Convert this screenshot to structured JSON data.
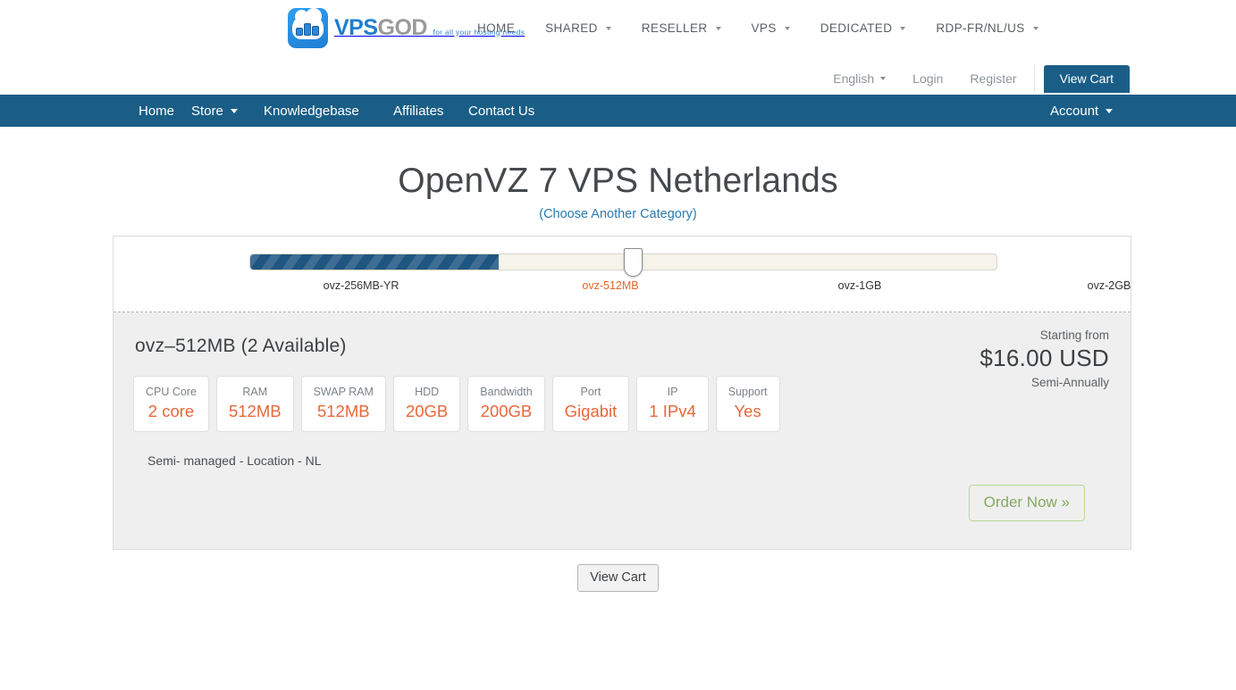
{
  "header": {
    "logo": {
      "text_primary": "VPS",
      "text_secondary": "GOD",
      "tagline": "for all your hosting needs"
    },
    "main_nav": [
      {
        "label": "HOME",
        "has_caret": false
      },
      {
        "label": "SHARED",
        "has_caret": true
      },
      {
        "label": "RESELLER",
        "has_caret": true
      },
      {
        "label": "VPS",
        "has_caret": true
      },
      {
        "label": "DEDICATED",
        "has_caret": true
      },
      {
        "label": "RDP-FR/NL/US",
        "has_caret": true
      }
    ],
    "utility_nav": {
      "language": "English",
      "login": "Login",
      "register": "Register",
      "view_cart": "View Cart"
    }
  },
  "blue_nav": {
    "items": [
      {
        "label": "Home",
        "has_caret": false
      },
      {
        "label": "Store",
        "has_caret": true
      },
      {
        "label": "Knowledgebase",
        "has_caret": false
      },
      {
        "label": "Affiliates",
        "has_caret": false
      },
      {
        "label": "Contact Us",
        "has_caret": false
      }
    ],
    "account": "Account"
  },
  "main": {
    "title": "OpenVZ 7 VPS Netherlands",
    "subtitle_link": "(Choose Another Category)",
    "slider": {
      "options": [
        "ovz-256MB-YR",
        "ovz-512MB",
        "ovz-1GB",
        "ovz-2GB"
      ],
      "selected_index": 1,
      "selected_label": "ovz-512MB",
      "fill_color": "#1f5581",
      "track_color": "#f5f3ea",
      "active_label_color": "#e2662a"
    },
    "product": {
      "name": "ovz–512MB (2 Available)",
      "description": "Semi- managed - Location - NL",
      "specs": [
        {
          "label": "CPU Core",
          "value": "2 core"
        },
        {
          "label": "RAM",
          "value": "512MB"
        },
        {
          "label": "SWAP RAM",
          "value": "512MB"
        },
        {
          "label": "HDD",
          "value": "20GB"
        },
        {
          "label": "Bandwidth",
          "value": "200GB"
        },
        {
          "label": "Port",
          "value": "Gigabit"
        },
        {
          "label": "IP",
          "value": "1 IPv4"
        },
        {
          "label": "Support",
          "value": "Yes"
        }
      ],
      "price": {
        "starting_from": "Starting from",
        "amount": "$16.00 USD",
        "cycle": "Semi-Annually"
      },
      "order_button": "Order Now »",
      "spec_value_color": "#e8673a"
    },
    "view_cart_bottom": "View Cart"
  }
}
